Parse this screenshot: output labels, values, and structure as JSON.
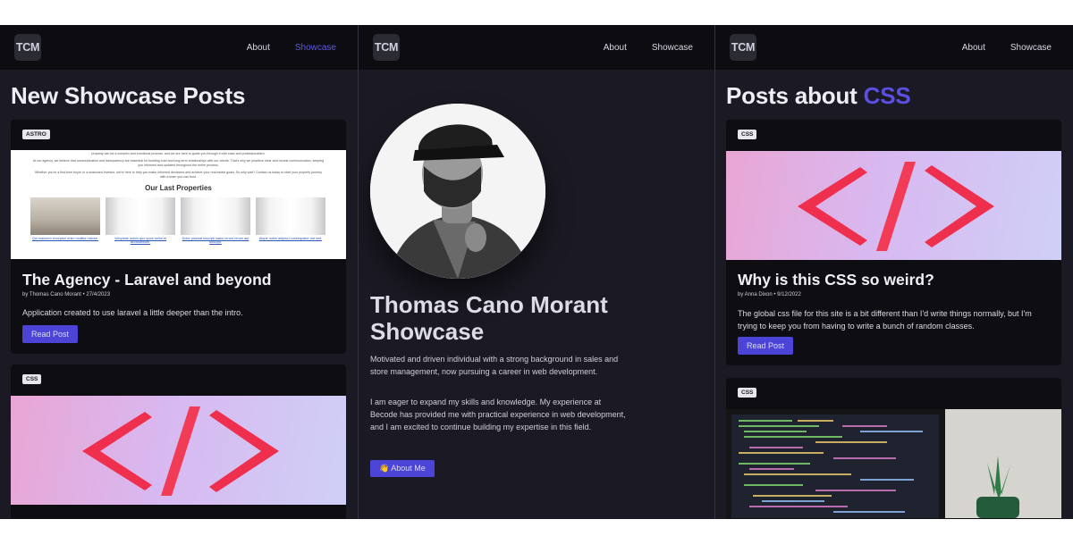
{
  "nav": {
    "logo": "TCM",
    "about": "About",
    "showcase": "Showcase"
  },
  "colors": {
    "accent": "#5a4fe0",
    "background": "#1b1a24",
    "card": "#0d0d12",
    "button": "#4b44d6"
  },
  "left": {
    "heading": "New Showcase Posts",
    "cards": [
      {
        "tag": "ASTRO",
        "title": "The Agency - Laravel and beyond",
        "meta": "by Thomas Cano Morant • 27/4/2023",
        "desc": "Application created to use laravel a little deeper than the intro.",
        "button": "Read Post",
        "thumb": {
          "para1": "property can be a complex and emotional process, and we are here to guide you through it with ease and professionalism.",
          "para2": "At our agency, we believe that communication and transparency are essential for building trust and long-term relationships with our clients. That's why we prioritize clear and honest communication, keeping you informed and updated throughout the entire process.",
          "para3": "Whether you're a first-time buyer or a seasoned investor, we're here to help you make informed decisions and achieve your real estate goals. So why wait? Contact us today to start your property journey with a team you can trust.",
          "heading": "Our Last Properties",
          "links": [
            "Qui maiorem excepturi enim mollitia ratione.",
            "Voluptate omnis quo quos animi et accusantium.",
            "Dolor placeat suscipit natus rerum rerum aut suscipit.",
            "Atque nobis adipisci consequatur aut sed."
          ]
        }
      },
      {
        "tag": "CSS"
      }
    ]
  },
  "middle": {
    "title_line1": "Thomas Cano Morant",
    "title_line2": "Showcase",
    "p1": "Motivated and driven individual with a strong background in sales and store management, now pursuing a career in web development.",
    "p2": "I am eager to expand my skills and knowledge. My experience at Becode has provided me with practical experience in web development, and I am excited to continue building my expertise in this field.",
    "button": "👋 About Me"
  },
  "right": {
    "heading_prefix": "Posts about ",
    "heading_accent": "CSS",
    "cards": [
      {
        "tag": "CSS",
        "title": "Why is this CSS so weird?",
        "meta": "by Anna Dixon • 9/12/2022",
        "desc": "The global css file for this site is a bit different than I'd write things normally, but I'm trying to keep you from having to write a bunch of random classes.",
        "button": "Read Post"
      },
      {
        "tag": "CSS"
      }
    ]
  }
}
